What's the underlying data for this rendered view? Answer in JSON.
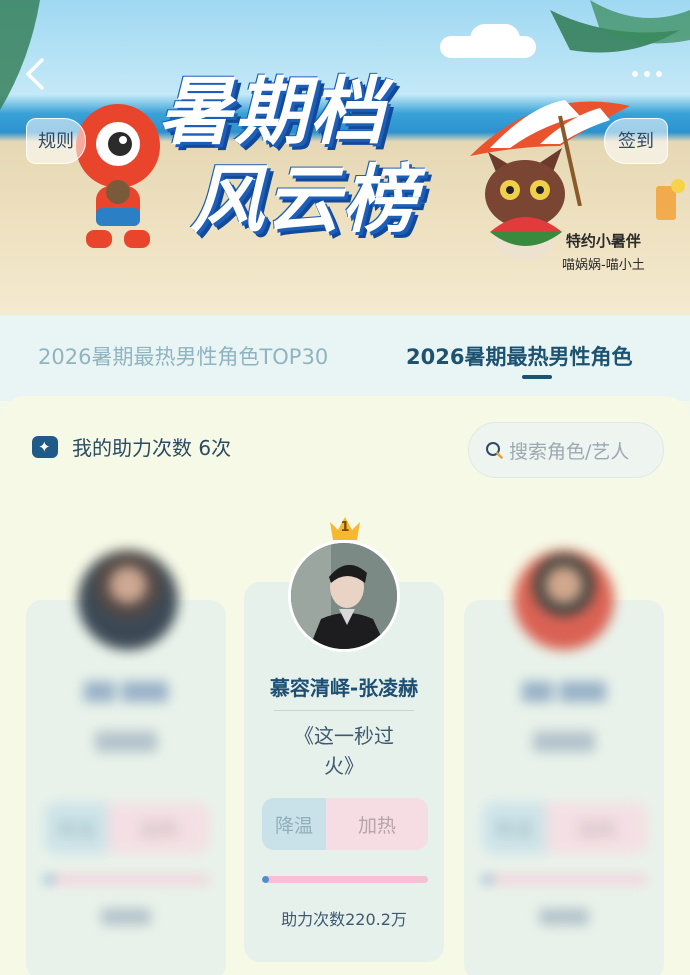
{
  "banner": {
    "title_line1": "暑期档",
    "title_line2": "风云榜",
    "rules_label": "规则",
    "checkin_label": "签到",
    "sponsor_title": "特约小暑伴",
    "sponsor_name": "喵娲娲-喵小土"
  },
  "tabs": [
    {
      "label": "2026暑期最热男性角色TOP30",
      "active": false
    },
    {
      "label": "2026暑期最热男性角色",
      "active": true
    }
  ],
  "boost": {
    "text": "我的助力次数 6次"
  },
  "search": {
    "placeholder": "搜索角色/艺人"
  },
  "cards": [
    {
      "rank": "",
      "name": "",
      "work": "",
      "cool_label": "降温",
      "heat_label": "加热",
      "progress": 0.06,
      "count": "",
      "blurred": true
    },
    {
      "rank": "1",
      "name": "慕容清峄-张凌赫",
      "work_line1": "《这一秒过",
      "work_line2": "火》",
      "cool_label": "降温",
      "heat_label": "加热",
      "progress": 0.04,
      "count": "助力次数220.2万",
      "blurred": false
    },
    {
      "rank": "",
      "name": "",
      "work": "",
      "cool_label": "降温",
      "heat_label": "加热",
      "progress": 0.06,
      "count": "",
      "blurred": true
    }
  ],
  "colors": {
    "accent": "#1d5370",
    "heat_bar": "#f7bfd5",
    "cool_fill": "#4f8fc9",
    "crown": "#f5b82e"
  }
}
